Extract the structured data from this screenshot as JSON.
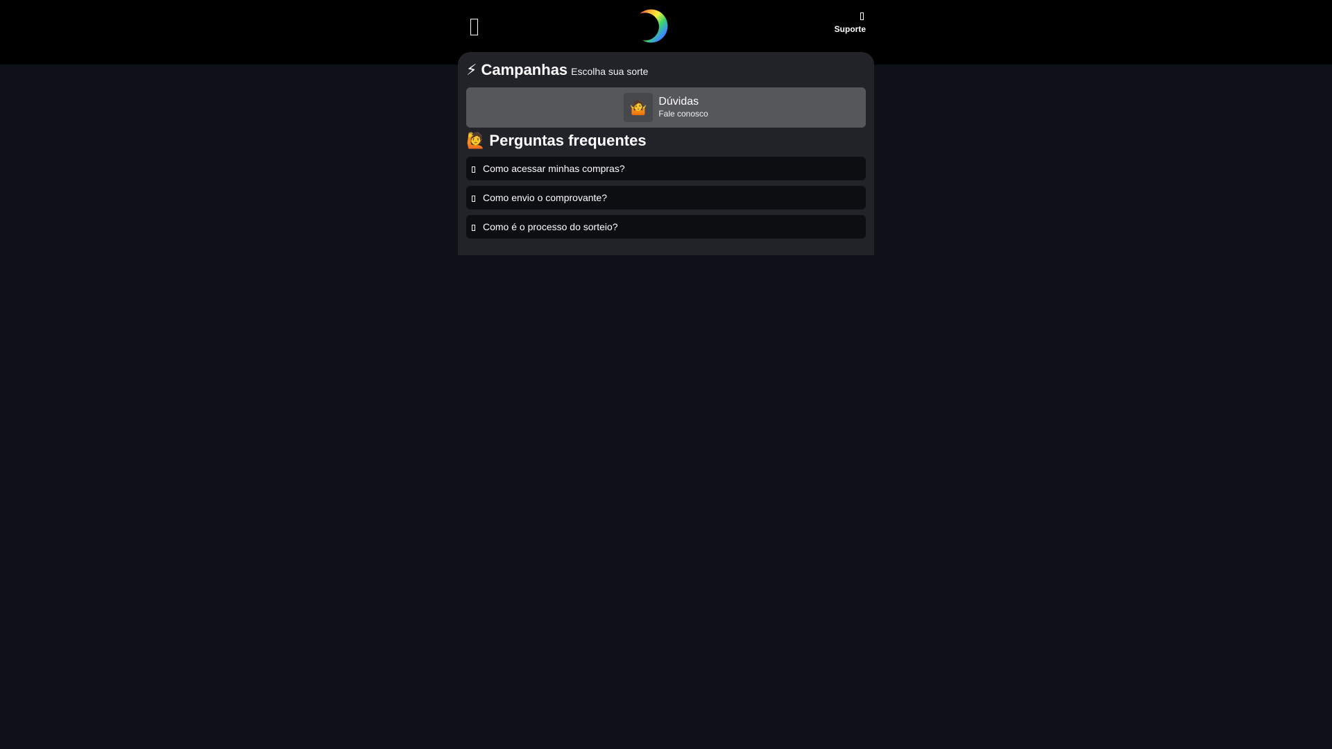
{
  "header": {
    "menu_icon": "menu-icon",
    "logo_icon": "rainbow-crescent-logo",
    "support_icon": "support-icon",
    "support_label": "Suporte"
  },
  "campaigns": {
    "emoji": "⚡",
    "title": "Campanhas",
    "subtitle": "Escolha sua sorte"
  },
  "contact": {
    "emoji": "🤷",
    "title": "Dúvidas",
    "subtitle": "Fale conosco"
  },
  "faq": {
    "emoji": "🙋",
    "title": "Perguntas frequentes",
    "items": [
      {
        "question": "Como acessar minhas compras?"
      },
      {
        "question": "Como envio o comprovante?"
      },
      {
        "question": "Como é o processo do sorteio?"
      }
    ]
  },
  "colors": {
    "page_background": "#0e1117",
    "header_background": "#000000",
    "panel_background": "#212328",
    "contact_card": "#55575b",
    "faq_item": "#0c0e12"
  }
}
